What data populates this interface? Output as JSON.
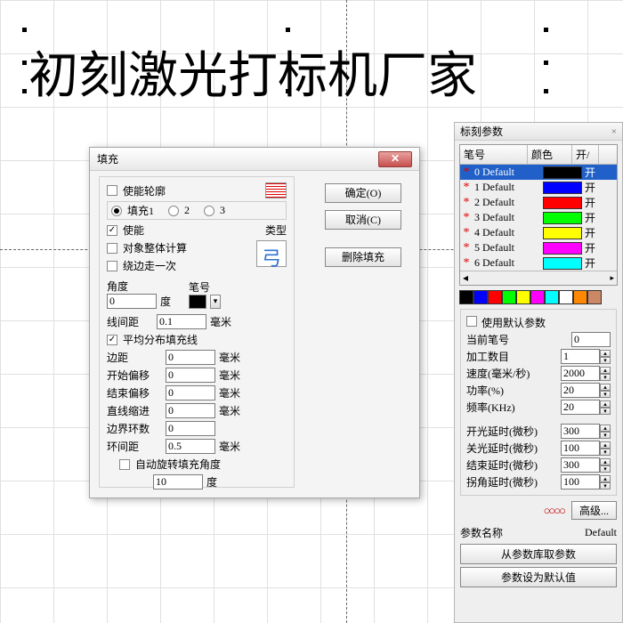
{
  "canvas_text": "初刻激光打标机厂家",
  "dialog": {
    "title": "填充",
    "enable_outline": "使能轮廓",
    "fill_prefix": "填充1",
    "r2": "2",
    "r3": "3",
    "enable": "使能",
    "type_label": "类型",
    "whole_calc": "对象整体计算",
    "walk_once": "绕边走一次",
    "angle_label": "角度",
    "angle_val": "0",
    "deg": "度",
    "pen_label": "笔号",
    "line_gap_label": "线间距",
    "line_gap_val": "0.1",
    "mm": "毫米",
    "avg_dist": "平均分布填充线",
    "margin": "边距",
    "margin_val": "0",
    "start_off": "开始偏移",
    "start_off_val": "0",
    "end_off": "结束偏移",
    "end_off_val": "0",
    "line_red": "直线缩进",
    "line_red_val": "0",
    "edge_loops": "边界环数",
    "edge_loops_val": "0",
    "ring_gap": "环间距",
    "ring_gap_val": "0.5",
    "auto_rot": "自动旋转填充角度",
    "rot_val": "10",
    "ok": "确定(O)",
    "cancel": "取消(C)",
    "delete": "删除填充"
  },
  "side": {
    "title": "标刻参数",
    "hdr_pen": "笔号",
    "hdr_color": "颜色",
    "hdr_on": "开/",
    "pens": [
      {
        "name": "0 Default",
        "color": "#000000",
        "on": "开",
        "sel": true
      },
      {
        "name": "1 Default",
        "color": "#0000ff",
        "on": "开"
      },
      {
        "name": "2 Default",
        "color": "#ff0000",
        "on": "开"
      },
      {
        "name": "3 Default",
        "color": "#00ff00",
        "on": "开"
      },
      {
        "name": "4 Default",
        "color": "#ffff00",
        "on": "开"
      },
      {
        "name": "5 Default",
        "color": "#ff00ff",
        "on": "开"
      },
      {
        "name": "6 Default",
        "color": "#00ffff",
        "on": "开"
      }
    ],
    "palette": [
      "#000000",
      "#0000ff",
      "#ff0000",
      "#00ff00",
      "#ffff00",
      "#ff00ff",
      "#00ffff",
      "#ffffff",
      "#ff8800",
      "#cc8866"
    ],
    "use_default": "使用默认参数",
    "cur_pen": "当前笔号",
    "cur_pen_val": "0",
    "count": "加工数目",
    "count_val": "1",
    "speed": "速度(毫米/秒)",
    "speed_val": "2000",
    "power": "功率(%)",
    "power_val": "20",
    "freq": "频率(KHz)",
    "freq_val": "20",
    "on_delay": "开光延时(微秒)",
    "on_delay_val": "300",
    "off_delay": "关光延时(微秒)",
    "off_delay_val": "100",
    "end_delay": "结束延时(微秒)",
    "end_delay_val": "300",
    "corner_delay": "拐角延时(微秒)",
    "corner_delay_val": "100",
    "advanced": "高级...",
    "param_name": "参数名称",
    "param_name_val": "Default",
    "from_lib": "从参数库取参数",
    "set_default": "参数设为默认值"
  }
}
